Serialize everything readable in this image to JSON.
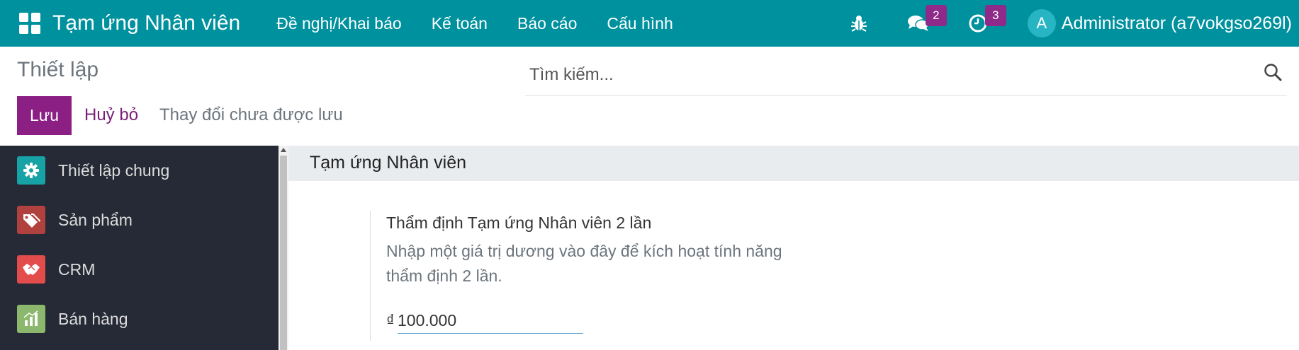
{
  "navbar": {
    "app_title": "Tạm ứng Nhân viên",
    "menu": [
      "Đề nghị/Khai báo",
      "Kế toán",
      "Báo cáo",
      "Cấu hình"
    ],
    "messages_count": "2",
    "activities_count": "3",
    "avatar_letter": "A",
    "user_name": "Administrator (a7vokgso269l)"
  },
  "control_panel": {
    "title": "Thiết lập",
    "search_placeholder": "Tìm kiếm...",
    "save_label": "Lưu",
    "discard_label": "Huỷ bỏ",
    "unsaved_label": "Thay đổi chưa được lưu"
  },
  "sidebar": {
    "items": [
      {
        "label": "Thiết lập chung",
        "icon": "gear-icon",
        "color": "#17a2a6"
      },
      {
        "label": "Sản phẩm",
        "icon": "tags-icon",
        "color": "#b0413e"
      },
      {
        "label": "CRM",
        "icon": "handshake-icon",
        "color": "#e24c4b"
      },
      {
        "label": "Bán hàng",
        "icon": "sales-chart-icon",
        "color": "#8bb86c"
      }
    ]
  },
  "main": {
    "section_title": "Tạm ứng Nhân viên",
    "setting": {
      "label": "Thẩm định Tạm ứng Nhân viên 2 lần",
      "description": "Nhập một giá trị dương vào đây để kích hoạt tính năng thẩm định 2 lần.",
      "currency_symbol": "₫",
      "value": "100.000"
    }
  },
  "colors": {
    "navbar": "#00919e",
    "primary": "#8b1f84",
    "sidebar": "#262a36",
    "badge": "#8f2a8a"
  }
}
